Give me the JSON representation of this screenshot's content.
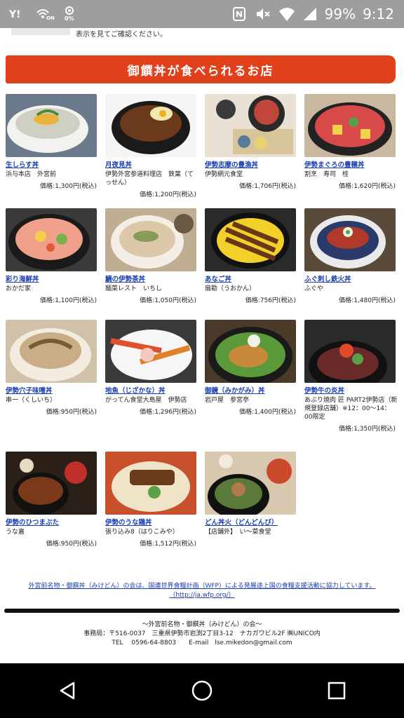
{
  "status_bar": {
    "carrier_icon": "yahoo-icon",
    "wifi_on": "ON",
    "data_pct": "0%",
    "battery": "99%",
    "time": "9:12"
  },
  "top_fragment": "表示を見てご確認ください。",
  "banner": {
    "title": "御饌丼が食べられるお店"
  },
  "items": [
    {
      "name": "生しらす丼",
      "shop": "浜与本店　外宮前",
      "price": "価格:1,300円(税込)"
    },
    {
      "name": "月夜見丼",
      "shop": "伊勢外宮参道料理店　鉄葉（てっせん）",
      "price": "価格:1,200円(税込)"
    },
    {
      "name": "伊勢志摩の豊漁丼",
      "shop": "伊勢網元食堂",
      "price": "価格:1,706円(税込)"
    },
    {
      "name": "伊勢まぐろの豊穣丼",
      "shop": "割烹　寿司　桂",
      "price": "価格:1,620円(税込)"
    },
    {
      "name": "彩り海鮮丼",
      "shop": "おかだ家",
      "price": "価格:1,100円(税込)"
    },
    {
      "name": "鯛の伊勢茶丼",
      "shop": "麺菜レスト　いちし",
      "price": "価格:1,050円(税込)"
    },
    {
      "name": "あなご丼",
      "shop": "扇勘（うおかん）",
      "price": "価格:756円(税込)"
    },
    {
      "name": "ふぐ刺し鉄火丼",
      "shop": "ふぐや",
      "price": "価格:1,480円(税込)"
    },
    {
      "name": "伊勢穴子味噌丼",
      "shop": "串一（くしいち）",
      "price": "価格:950円(税込)"
    },
    {
      "name": "地魚（じざかな）丼",
      "shop": "がってん食堂大島屋　伊勢店",
      "price": "価格:1,296円(税込)"
    },
    {
      "name": "御鏡（みかがみ）丼",
      "shop": "岩戸屋　参宮亭",
      "price": "価格:1,400円(税込)"
    },
    {
      "name": "伊勢牛の炎丼",
      "shop": "あぶり焼肉 匠 PART2伊勢店（新規登録店舗）※12：00～14：00限定",
      "price": "価格:1,350円(税込)"
    },
    {
      "name": "伊勢のひつまぶた",
      "shop": "うな嘉",
      "price": "価格:950円(税込)"
    },
    {
      "name": "伊勢のうな鶏丼",
      "shop": "張り込み8（はりこみや）",
      "price": "価格:1,512円(税込)"
    },
    {
      "name": "どん丼火（どんどんび）",
      "shop": "【店舗外】　い～菜食堂",
      "price": ""
    }
  ],
  "footer_link": {
    "line1": "外宮前名物・御饌丼（みけどん）の会は、国連世界食糧計画（WFP）による発展途上国の食糧支援活動に協力しています。",
    "line2": "（http://ja.wfp.org/）"
  },
  "footer": {
    "org": "～外宮前名物・御饌丼（みけどん）の会～",
    "address": "事務局：〒516-0037　三重県伊勢市岩渕2丁目3-12　ナカガワビル2F ㈱UNICO内",
    "contact": "TEL　 0596-64-8803　　E-mail　lse.mikedon@gmail.com"
  },
  "nav": {
    "back": "back-icon",
    "home": "home-icon",
    "recents": "recents-icon"
  },
  "colors": {
    "banner": "#e0401a",
    "link": "#1a3fb0",
    "statusbar": "#9e9e9e"
  }
}
